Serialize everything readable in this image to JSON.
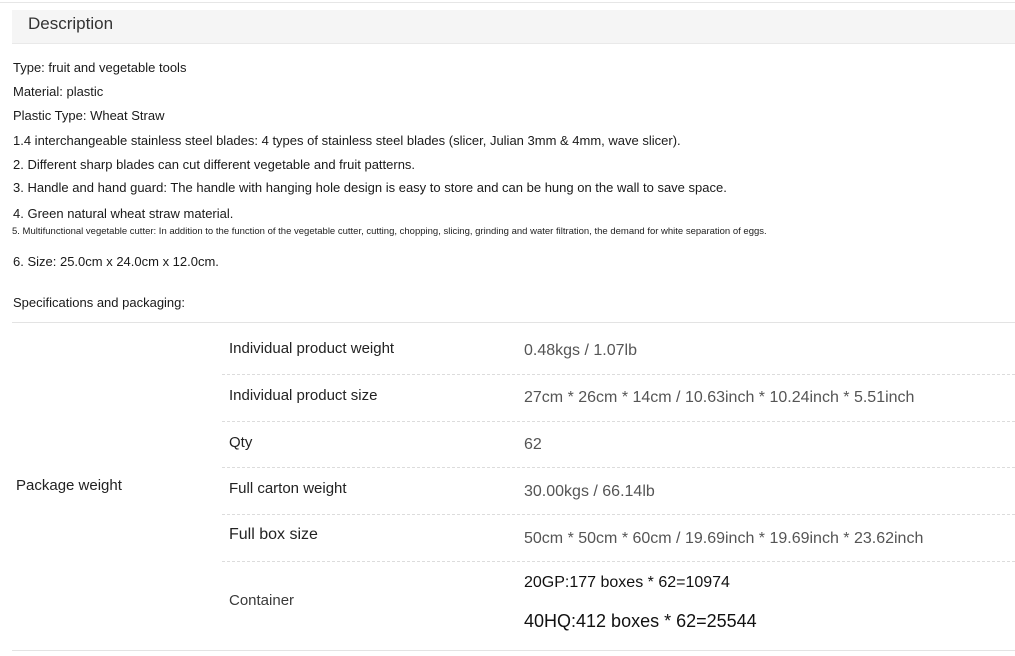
{
  "description": {
    "title": "Description",
    "lines": [
      "Type: fruit and vegetable tools",
      "Material: plastic",
      "Plastic Type: Wheat Straw",
      "1.4 interchangeable stainless steel blades: 4 types of stainless steel blades (slicer, Julian 3mm & 4mm, wave slicer).",
      "2. Different sharp blades can cut different vegetable and fruit patterns.",
      "3. Handle and hand guard: The handle with hanging hole design is easy to store and can be hung on the wall to save space.",
      "4. Green natural wheat straw material.",
      "5. Multifunctional vegetable cutter: In addition to the function of the vegetable cutter, cutting, chopping, slicing, grinding and water filtration, the demand for white separation of eggs.",
      "6. Size: 25.0cm x 24.0cm x 12.0cm."
    ]
  },
  "specs": {
    "title": "Specifications and packaging:",
    "group_label": "Package weight",
    "rows": [
      {
        "label": "Individual product weight",
        "value": "0.48kgs / 1.07lb"
      },
      {
        "label": "Individual product size",
        "value": "27cm * 26cm * 14cm / 10.63inch * 10.24inch * 5.51inch"
      },
      {
        "label": "Qty",
        "value": "62"
      },
      {
        "label": "Full carton weight",
        "value": "30.00kgs / 66.14lb"
      },
      {
        "label": "Full box size",
        "value": "50cm * 50cm * 60cm / 19.69inch * 19.69inch * 23.62inch"
      }
    ],
    "container": {
      "label": "Container",
      "values": [
        "20GP:177 boxes * 62=10974",
        "40HQ:412 boxes * 62=25544"
      ]
    }
  }
}
